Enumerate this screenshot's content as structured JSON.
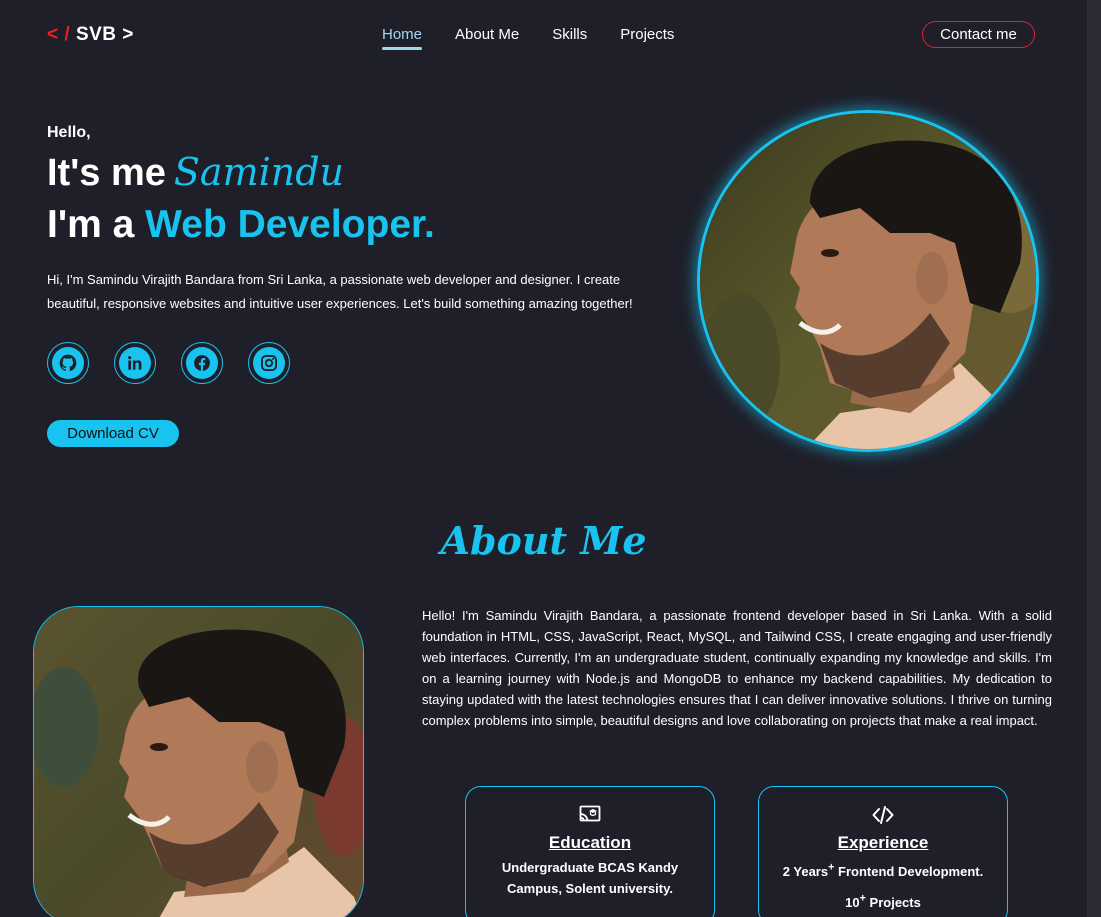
{
  "nav": {
    "logo_open": "< /",
    "logo_name": "SVB >",
    "links": [
      "Home",
      "About Me",
      "Skills",
      "Projects"
    ],
    "contact_label": "Contact me"
  },
  "hero": {
    "hello": "Hello,",
    "its_me": "It's me",
    "name": "Samindu",
    "im_a": "I'm a",
    "role": "Web Developer.",
    "intro_line1": "Hi, I'm Samindu Virajith Bandara from Sri Lanka, a passionate web developer and designer. I create",
    "intro_line2": "beautiful, responsive websites and intuitive user experiences. Let's build something amazing together!",
    "socials": [
      "github-icon",
      "linkedin-icon",
      "facebook-icon",
      "instagram-icon"
    ],
    "cv_label": "Download CV"
  },
  "about": {
    "title": "About Me",
    "text": "Hello! I'm Samindu Virajith Bandara, a passionate frontend developer based in Sri Lanka. With a solid foundation in HTML, CSS, JavaScript, React, MySQL, and Tailwind CSS, I create engaging and user-friendly web interfaces. Currently, I'm an undergraduate student, continually expanding my knowledge and skills. I'm on a learning journey with Node.js and MongoDB to enhance my backend capabilities. My dedication to staying updated with the latest technologies ensures that I can deliver innovative solutions. I thrive on turning complex problems into simple, beautiful designs and love collaborating on projects that make a real impact.",
    "education": {
      "title": "Education",
      "body": "Undergraduate BCAS Kandy Campus, Solent university.",
      "icon": "education-icon"
    },
    "experience": {
      "title": "Experience",
      "line1_num": "2 Years",
      "line1_sup": "+",
      "line1_rest": " Frontend Development.",
      "line2_num": "10",
      "line2_sup": "+",
      "line2_rest": " Projects",
      "icon": "code-icon"
    }
  },
  "colors": {
    "background": "#1f1f29",
    "accent": "#19c3f0",
    "logo_red": "#e5202b"
  }
}
